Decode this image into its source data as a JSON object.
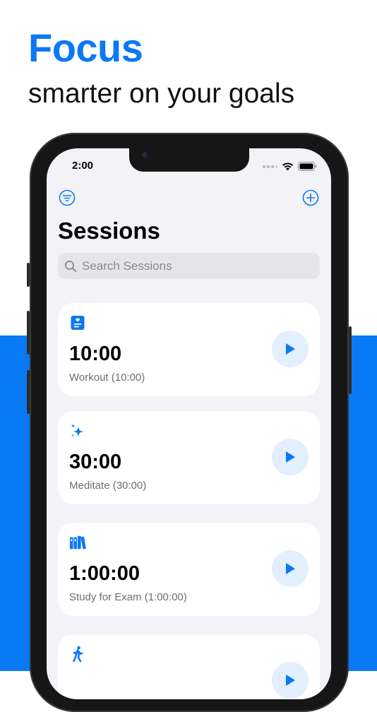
{
  "headline": "Focus",
  "subheadline": "smarter on your goals",
  "status_bar": {
    "time": "2:00"
  },
  "nav": {
    "title": "Sessions",
    "filter_icon": "filter-circle-icon",
    "add_icon": "plus-circle-icon"
  },
  "search": {
    "placeholder": "Search Sessions",
    "value": ""
  },
  "sessions": [
    {
      "icon": "id-card-icon",
      "duration": "10:00",
      "label": "Workout (10:00)"
    },
    {
      "icon": "sparkles-icon",
      "duration": "30:00",
      "label": "Meditate (30:00)"
    },
    {
      "icon": "books-icon",
      "duration": "1:00:00",
      "label": "Study for Exam (1:00:00)"
    },
    {
      "icon": "walking-figure-icon",
      "duration": "",
      "label": ""
    }
  ],
  "colors": {
    "accent": "#0a79f6",
    "background": "#f2f2f7",
    "card": "#ffffff",
    "play_bg": "#e3efff"
  }
}
